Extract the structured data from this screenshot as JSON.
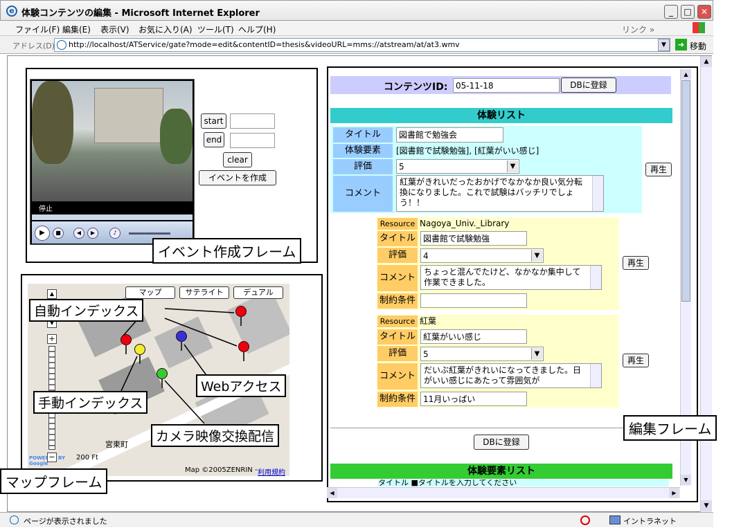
{
  "window": {
    "title": "体験コンテンツの編集 - Microsoft Internet Explorer",
    "link_label": "リンク »",
    "go_label": "移動"
  },
  "menu": [
    "ファイル(F)",
    "編集(E)",
    "表示(V)",
    "お気に入り(A)",
    "ツール(T)",
    "ヘルプ(H)"
  ],
  "address": {
    "label": "アドレス(D)",
    "url": "http://localhost/ATService/gate?mode=edit&contentID=thesis&videoURL=mms://atstream/at/at3.wmv"
  },
  "event_frame": {
    "video_status": "停止",
    "start_label": "start",
    "end_label": "end",
    "clear_label": "clear",
    "create_event_label": "イベントを作成",
    "frame_caption": "イベント作成フレーム"
  },
  "map_frame": {
    "tabs": [
      "マップ",
      "サテライト",
      "デュアル"
    ],
    "scale_label": "200 Ft",
    "place_label": "宮東町",
    "copyright": "Map ©2005ZENRIN -",
    "terms_link": "利用規約",
    "logo": "POWERED BY Google",
    "frame_caption": "マップフレーム",
    "annotations": {
      "auto_index": "自動インデックス",
      "manual_index": "手動インデックス",
      "web_access": "Webアクセス",
      "camera": "カメラ映像交換配信"
    }
  },
  "edit_frame": {
    "content_id_label": "コンテンツID:",
    "content_id_value": "05-11-18",
    "register_label": "DBに登録",
    "experience_list_title": "体験リスト",
    "experience": {
      "title_label": "タイトル",
      "title_value": "図書館で勉強会",
      "elements_label": "体験要素",
      "elements_value": "[図書館で試験勉強], [紅葉がいい感じ]",
      "rating_label": "評価",
      "rating_value": "5",
      "comment_label": "コメント",
      "comment_value": "紅葉がきれいだったおかげでなかなか良い気分転換になりました。これで試験はバッチリでしょう！！",
      "play_label": "再生"
    },
    "resources": [
      {
        "resource_label": "Resource",
        "resource_value": "Nagoya_Univ._Library",
        "title_label": "タイトル",
        "title_value": "図書館で試験勉強",
        "rating_label": "評価",
        "rating_value": "4",
        "comment_label": "コメント",
        "comment_value": "ちょっと混んでたけど、なかなか集中して作業できました。",
        "constraint_label": "制約条件",
        "constraint_value": "",
        "play_label": "再生"
      },
      {
        "resource_label": "Resource",
        "resource_value": "紅葉",
        "title_label": "タイトル",
        "title_value": "紅葉がいい感じ",
        "rating_label": "評価",
        "rating_value": "5",
        "comment_label": "コメント",
        "comment_value": "だいぶ紅葉がきれいになってきました。日がいい感じにあたって雰囲気が",
        "constraint_label": "制約条件",
        "constraint_value": "11月いっぱい",
        "play_label": "再生"
      }
    ],
    "register_bottom_label": "DBに登録",
    "element_list_title": "体験要素リスト",
    "element_list_partial": "タイトル ■タイトルを入力してください",
    "frame_caption": "編集フレーム"
  },
  "status": {
    "text": "ページが表示されました",
    "zone": "イントラネット"
  },
  "colors": {
    "content_id_bg": "#ccccff",
    "section_head": "#33cccc",
    "element_head": "#33cc33",
    "label_blue": "#99ccff",
    "label_orange": "#ffcc66",
    "row_cyan": "#ccffff",
    "row_yellow": "#ffffcc"
  }
}
